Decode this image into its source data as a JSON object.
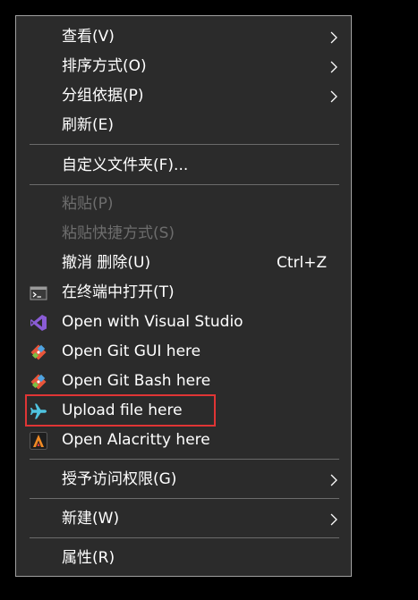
{
  "menu": {
    "view": "查看(V)",
    "sort_by": "排序方式(O)",
    "group_by": "分组依据(P)",
    "refresh": "刷新(E)",
    "customize_folder": "自定义文件夹(F)...",
    "paste": "粘贴(P)",
    "paste_shortcut": "粘贴快捷方式(S)",
    "undo_delete": "撤消 删除(U)",
    "undo_shortcut": "Ctrl+Z",
    "open_terminal": "在终端中打开(T)",
    "open_visual_studio": "Open with Visual Studio",
    "open_git_gui": "Open Git GUI here",
    "open_git_bash": "Open Git Bash here",
    "upload_file": "Upload file here",
    "open_alacritty": "Open Alacritty here",
    "grant_access": "授予访问权限(G)",
    "new": "新建(W)",
    "properties": "属性(R)"
  },
  "icons": {
    "terminal": "terminal-icon",
    "visual_studio": "visual-studio-icon",
    "git_gui": "git-icon",
    "git_bash": "git-icon",
    "upload": "airplane-icon",
    "alacritty": "alacritty-icon",
    "submenu": "chevron-right-icon"
  },
  "colors": {
    "menu_bg": "#2b2b2b",
    "text": "#ffffff",
    "disabled_text": "#6d6d6d",
    "highlight_border": "#e03535",
    "upload_icon": "#4fc3e0",
    "git_icon": "#e8553a",
    "vs_icon": "#8a5cd6"
  }
}
